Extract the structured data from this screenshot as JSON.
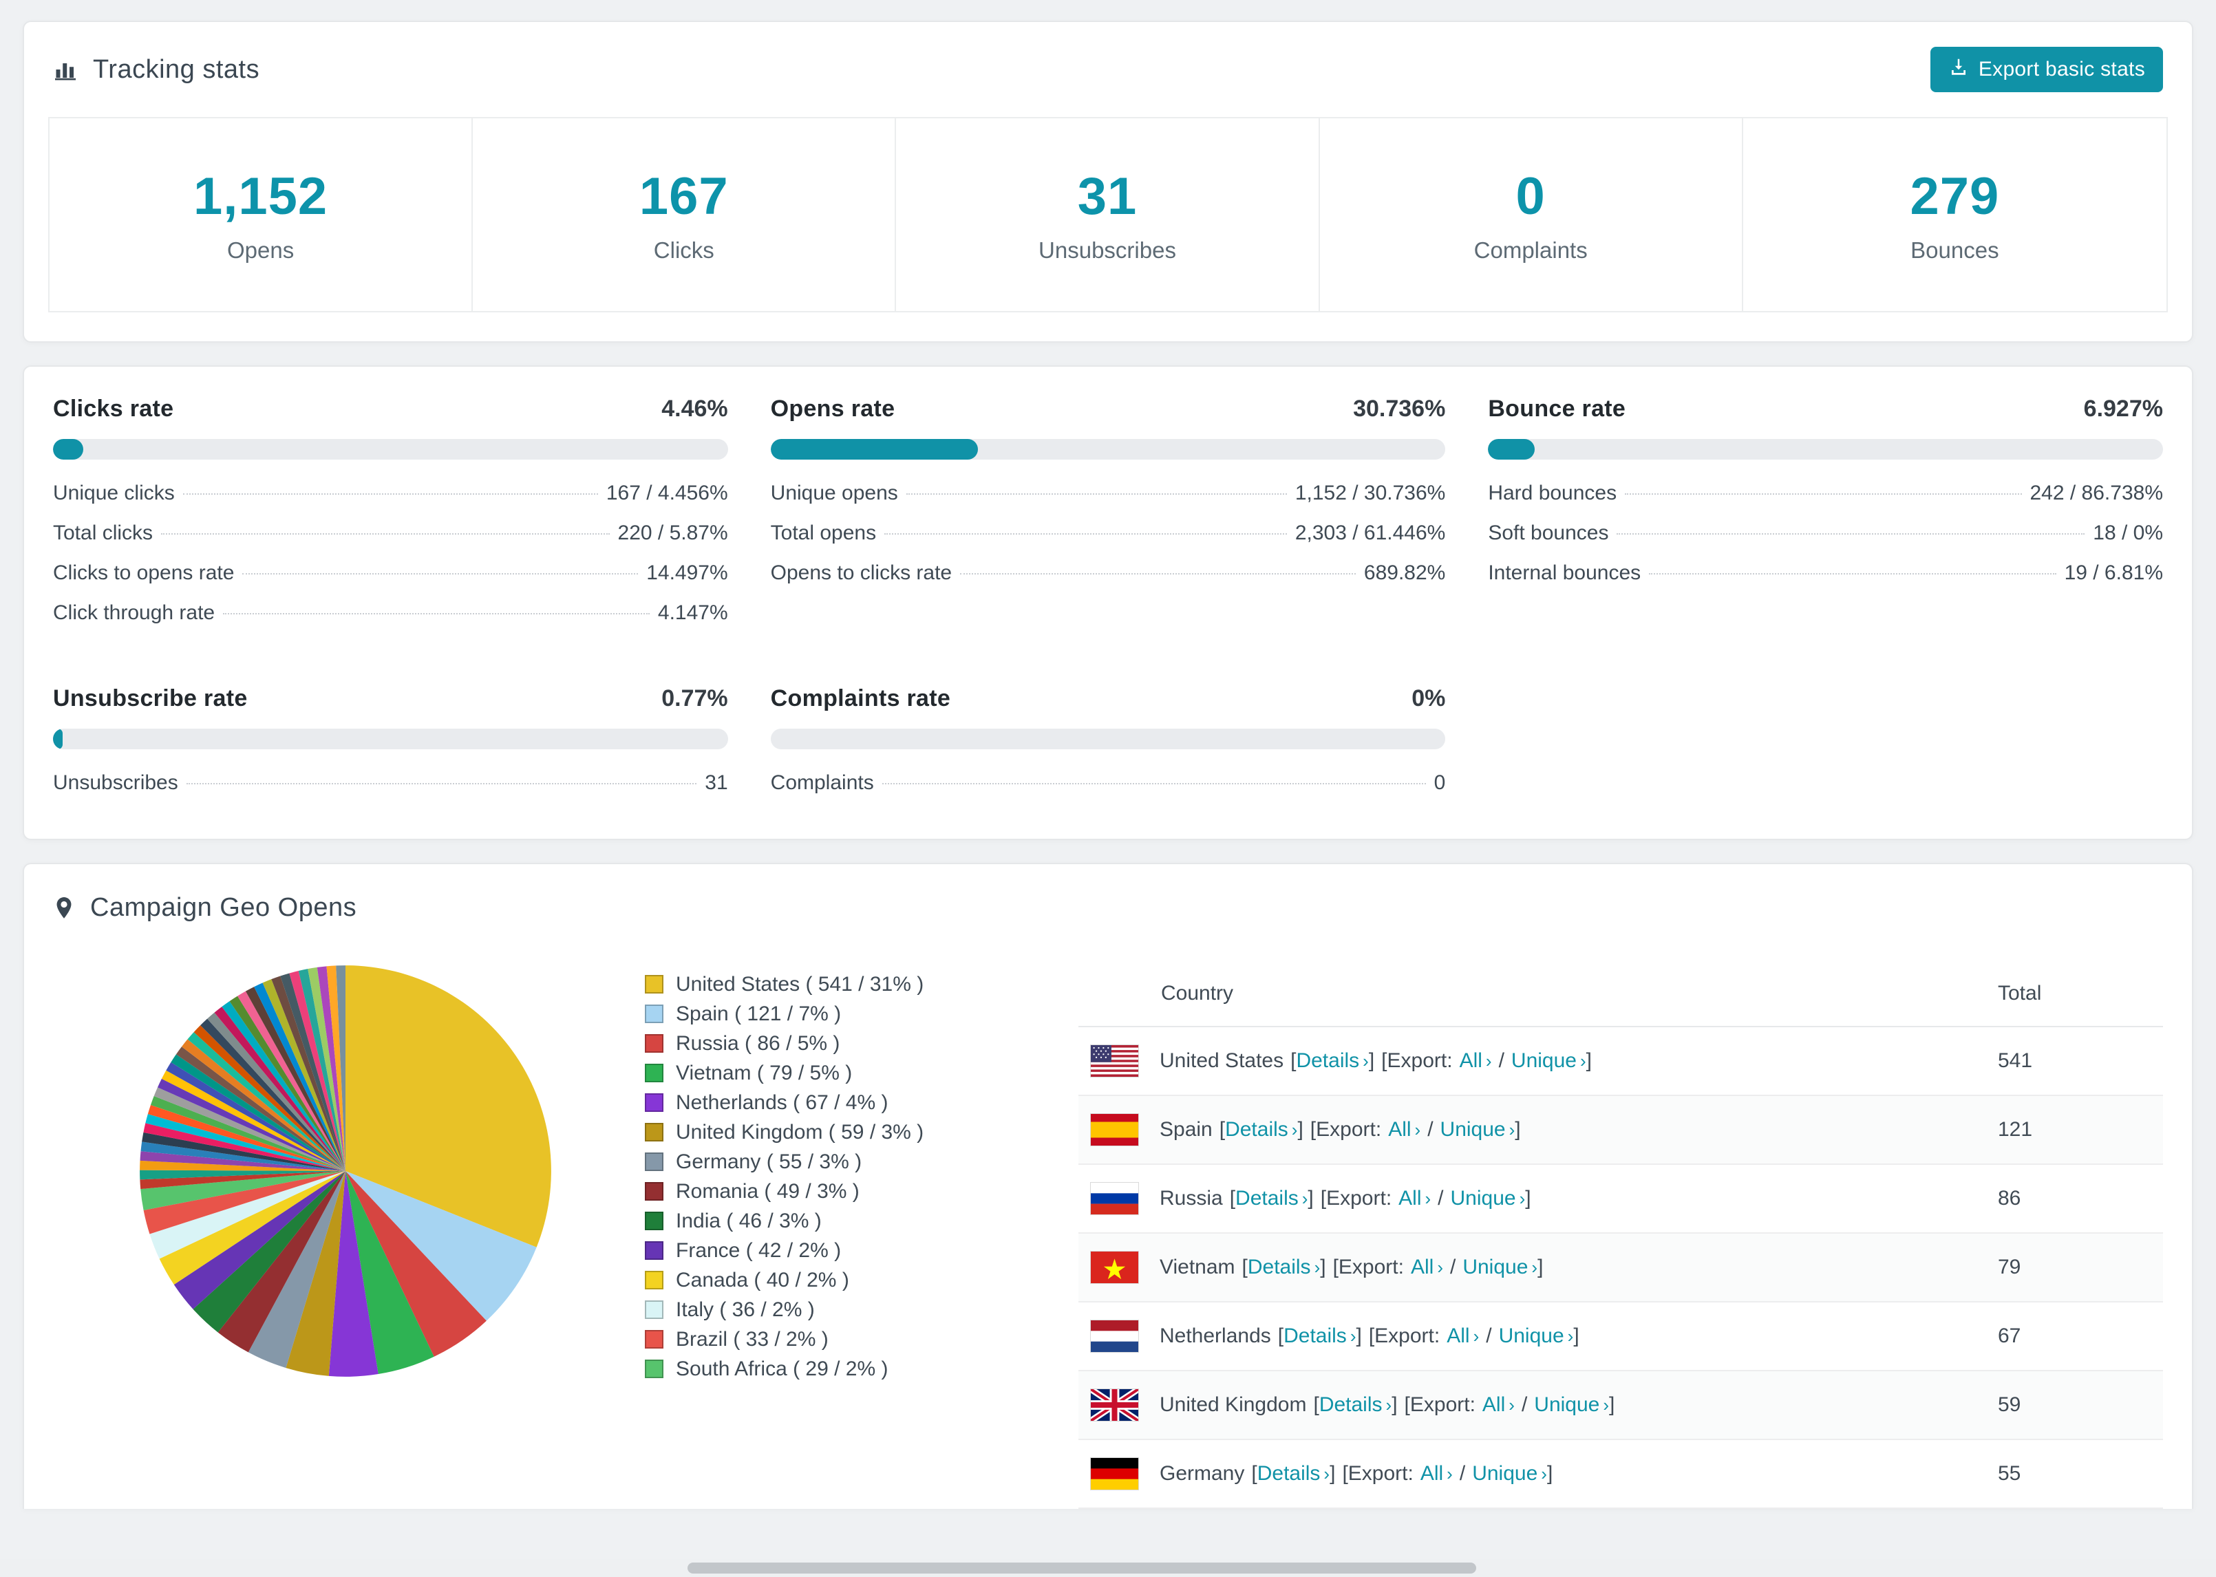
{
  "accent": "#1092a7",
  "tracking": {
    "title": "Tracking stats",
    "export_button": "Export basic stats",
    "stats": [
      {
        "value": "1,152",
        "label": "Opens"
      },
      {
        "value": "167",
        "label": "Clicks"
      },
      {
        "value": "31",
        "label": "Unsubscribes"
      },
      {
        "value": "0",
        "label": "Complaints"
      },
      {
        "value": "279",
        "label": "Bounces"
      }
    ]
  },
  "rates": [
    {
      "title": "Clicks rate",
      "value": "4.46%",
      "percent": 4.46,
      "rows": [
        {
          "label": "Unique clicks",
          "value": "167 / 4.456%"
        },
        {
          "label": "Total clicks",
          "value": "220 / 5.87%"
        },
        {
          "label": "Clicks to opens rate",
          "value": "14.497%"
        },
        {
          "label": "Click through rate",
          "value": "4.147%"
        }
      ]
    },
    {
      "title": "Opens rate",
      "value": "30.736%",
      "percent": 30.736,
      "rows": [
        {
          "label": "Unique opens",
          "value": "1,152 / 30.736%"
        },
        {
          "label": "Total opens",
          "value": "2,303 / 61.446%"
        },
        {
          "label": "Opens to clicks rate",
          "value": "689.82%"
        }
      ]
    },
    {
      "title": "Bounce rate",
      "value": "6.927%",
      "percent": 6.927,
      "rows": [
        {
          "label": "Hard bounces",
          "value": "242 / 86.738%"
        },
        {
          "label": "Soft bounces",
          "value": "18 / 0%"
        },
        {
          "label": "Internal bounces",
          "value": "19 / 6.81%"
        }
      ]
    },
    {
      "title": "Unsubscribe rate",
      "value": "0.77%",
      "percent": 0.77,
      "rows": [
        {
          "label": "Unsubscribes",
          "value": "31"
        }
      ]
    },
    {
      "title": "Complaints rate",
      "value": "0%",
      "percent": 0,
      "rows": [
        {
          "label": "Complaints",
          "value": "0"
        }
      ]
    }
  ],
  "geo": {
    "title": "Campaign Geo Opens",
    "chart_data": {
      "type": "pie",
      "title": "Campaign Geo Opens",
      "legend_position": "right",
      "slices": [
        {
          "label": "United States",
          "value": 541,
          "percent": 31,
          "color": "#e8c227",
          "display": "United States ( 541 / 31% )"
        },
        {
          "label": "Spain",
          "value": 121,
          "percent": 7,
          "color": "#a6d4f2",
          "display": "Spain ( 121 / 7% )"
        },
        {
          "label": "Russia",
          "value": 86,
          "percent": 5,
          "color": "#d64541",
          "display": "Russia ( 86 / 5% )"
        },
        {
          "label": "Vietnam",
          "value": 79,
          "percent": 5,
          "color": "#2eb353",
          "display": "Vietnam ( 79 / 5% )"
        },
        {
          "label": "Netherlands",
          "value": 67,
          "percent": 4,
          "color": "#8636d6",
          "display": "Netherlands ( 67 / 4% )"
        },
        {
          "label": "United Kingdom",
          "value": 59,
          "percent": 3,
          "color": "#bc9719",
          "display": "United Kingdom ( 59 / 3% )"
        },
        {
          "label": "Germany",
          "value": 55,
          "percent": 3,
          "color": "#8598a9",
          "display": "Germany ( 55 / 3% )"
        },
        {
          "label": "Romania",
          "value": 49,
          "percent": 3,
          "color": "#942f31",
          "display": "Romania ( 49 / 3% )"
        },
        {
          "label": "India",
          "value": 46,
          "percent": 3,
          "color": "#1f7f3a",
          "display": "India ( 46 / 3% )"
        },
        {
          "label": "France",
          "value": 42,
          "percent": 2,
          "color": "#6635b5",
          "display": "France ( 42 / 2% )"
        },
        {
          "label": "Canada",
          "value": 40,
          "percent": 2,
          "color": "#f3d321",
          "display": "Canada ( 40 / 2% )"
        },
        {
          "label": "Italy",
          "value": 36,
          "percent": 2,
          "color": "#d9f4f6",
          "display": "Italy ( 36 / 2% )"
        },
        {
          "label": "Brazil",
          "value": 33,
          "percent": 2,
          "color": "#e8544a",
          "display": "Brazil ( 33 / 2% )"
        },
        {
          "label": "South Africa",
          "value": 29,
          "percent": 2,
          "color": "#57c46d",
          "display": "South Africa ( 29 / 2% )"
        }
      ],
      "other_segment": {
        "note": "many small unlabeled country slices",
        "total_value": 460,
        "slice_count": 36,
        "palette": [
          "#c0392b",
          "#16a085",
          "#f39c12",
          "#8e44ad",
          "#2980b9",
          "#2c3e50",
          "#e91e63",
          "#00bcd4",
          "#ff5722",
          "#4caf50",
          "#9e9e9e",
          "#673ab7",
          "#ffc107",
          "#3f51b5",
          "#009688",
          "#795548",
          "#e67e22",
          "#1abc9c",
          "#d35400",
          "#34495e",
          "#7f8c8d",
          "#c2185b",
          "#00acc1",
          "#558b2f",
          "#f06292",
          "#5d4037",
          "#0288d1",
          "#afb42b",
          "#6d4c41",
          "#455a64",
          "#ec407a",
          "#26a69a",
          "#9ccc65",
          "#ab47bc",
          "#ffa726",
          "#78909c"
        ]
      }
    },
    "table": {
      "headers": {
        "country": "Country",
        "total": "Total"
      },
      "tokens": {
        "open_bracket": "[",
        "close_bracket": "]",
        "details": "Details",
        "export": "Export:",
        "all": "All",
        "unique": "Unique",
        "slash": "/",
        "chevron": "›"
      },
      "rows": [
        {
          "country": "United States",
          "total": "541"
        },
        {
          "country": "Spain",
          "total": "121"
        },
        {
          "country": "Russia",
          "total": "86"
        },
        {
          "country": "Vietnam",
          "total": "79"
        },
        {
          "country": "Netherlands",
          "total": "67"
        },
        {
          "country": "United Kingdom",
          "total": "59"
        },
        {
          "country": "Germany",
          "total": "55"
        }
      ]
    }
  }
}
